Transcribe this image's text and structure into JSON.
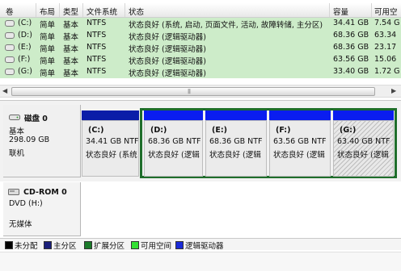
{
  "columns": [
    "卷",
    "布局",
    "类型",
    "文件系统",
    "状态",
    "容量",
    "可用空"
  ],
  "volumes": [
    {
      "name": "(C:)",
      "layout": "简单",
      "type": "基本",
      "fs": "NTFS",
      "status": "状态良好 (系统, 启动, 页面文件, 活动, 故障转储, 主分区)",
      "capacity": "34.41 GB",
      "free": "7.54 G"
    },
    {
      "name": "(D:)",
      "layout": "简单",
      "type": "基本",
      "fs": "NTFS",
      "status": "状态良好 (逻辑驱动器)",
      "capacity": "68.36 GB",
      "free": "63.34"
    },
    {
      "name": "(E:)",
      "layout": "简单",
      "type": "基本",
      "fs": "NTFS",
      "status": "状态良好 (逻辑驱动器)",
      "capacity": "68.36 GB",
      "free": "23.17"
    },
    {
      "name": "(F:)",
      "layout": "简单",
      "type": "基本",
      "fs": "NTFS",
      "status": "状态良好 (逻辑驱动器)",
      "capacity": "63.56 GB",
      "free": "15.06"
    },
    {
      "name": "(G:)",
      "layout": "简单",
      "type": "基本",
      "fs": "NTFS",
      "status": "状态良好 (逻辑驱动器)",
      "capacity": "33.40 GB",
      "free": "1.72 G"
    }
  ],
  "disk0": {
    "title": "磁盘 0",
    "kind": "基本",
    "size": "298.09 GB",
    "state": "联机"
  },
  "partitions": [
    {
      "letter": "(C:)",
      "size": "34.41 GB NTFS",
      "status": "状态良好 (系统"
    },
    {
      "letter": "(D:)",
      "size": "68.36 GB NTF",
      "status": "状态良好 (逻辑"
    },
    {
      "letter": "(E:)",
      "size": "68.36 GB NTF",
      "status": "状态良好 (逻辑"
    },
    {
      "letter": "(F:)",
      "size": "63.56 GB NTF",
      "status": "状态良好 (逻辑"
    },
    {
      "letter": "(G:)",
      "size": "63.40 GB NTF",
      "status": "状态良好 (逻辑"
    }
  ],
  "cdrom": {
    "title": "CD-ROM 0",
    "drive": "DVD (H:)",
    "media": "无媒体"
  },
  "legend": [
    {
      "label": "未分配",
      "color": "#000000"
    },
    {
      "label": "主分区",
      "color": "#1a1f7a"
    },
    {
      "label": "扩展分区",
      "color": "#1a7a2a"
    },
    {
      "label": "可用空间",
      "color": "#33e133"
    },
    {
      "label": "逻辑驱动器",
      "color": "#1a2ad8"
    }
  ],
  "colors": {
    "primary_bar": "#0a1da8",
    "logical_bar": "#0a1df0",
    "list_bg": "#cdecc9",
    "extended_frame": "#1f6e2b"
  }
}
